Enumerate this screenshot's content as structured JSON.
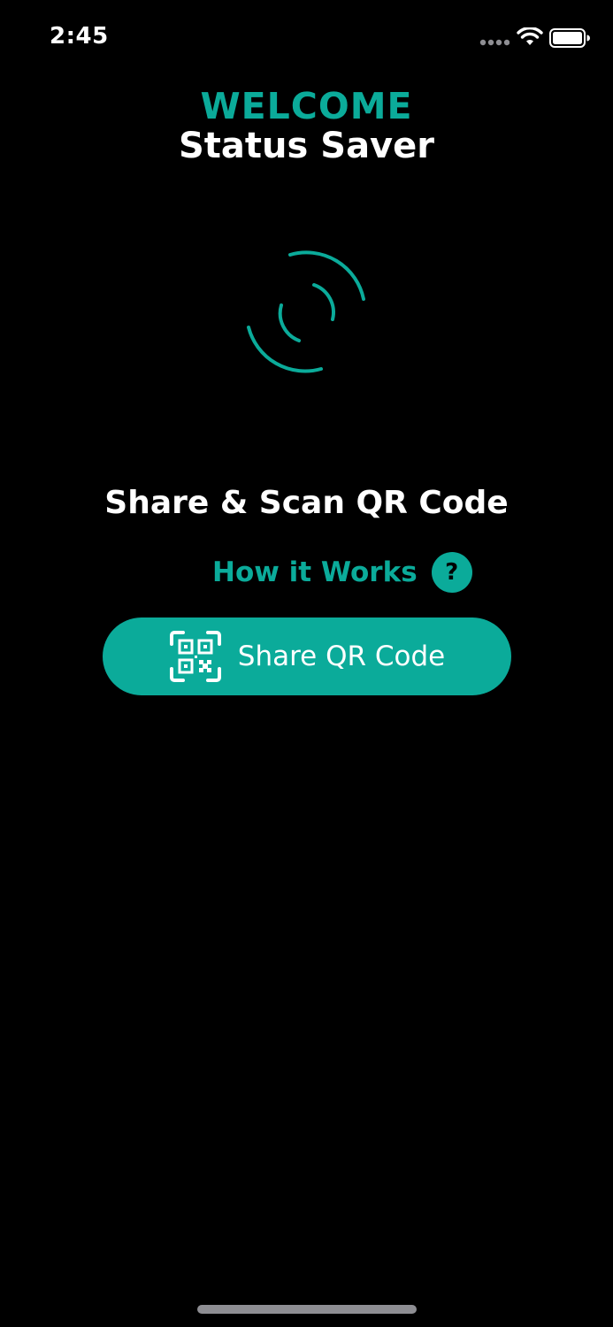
{
  "colors": {
    "background": "#000000",
    "accent": "#0bab9a",
    "text": "#ffffff"
  },
  "status_bar": {
    "time": "2:45",
    "icons": [
      "signal-dots-icon",
      "wifi-icon",
      "battery-icon"
    ]
  },
  "header": {
    "welcome": "WELCOME",
    "app_name": "Status Saver"
  },
  "loader": {
    "icon": "loading-arcs-icon"
  },
  "main": {
    "headline": "Share & Scan QR Code",
    "how_it_works": "How it Works",
    "help_badge": "?",
    "share_button": {
      "label": "Share QR Code",
      "icon": "qr-code-icon"
    }
  }
}
